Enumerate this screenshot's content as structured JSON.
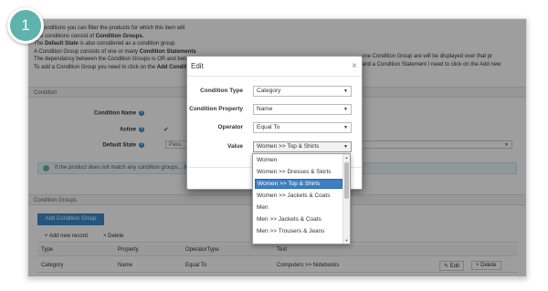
{
  "step_number": "1",
  "intro": {
    "line1": "ith conditions you can filter the products for which this item will",
    "line2_a": "The conditions consist of ",
    "line2_b": "Condition Groups.",
    "line3_a": "The ",
    "line3_b": "Default State",
    "line3_c": " is also considered as a condition group.",
    "line4_a": "A Condition Group consists of one or many ",
    "line4_b": "Condition Statements",
    "line5": "The dependancy between the Condition Groups is OR and betw",
    "line6_a": "To add a Condition Group you need to click on the ",
    "line6_b": "Add Conditi",
    "right1": "one Condition Group are will be displayed over that pr",
    "right2": "and a Condition Statement I need to click on the Add new"
  },
  "condition_section": {
    "header": "Condition",
    "name_label": "Condition Name",
    "active_label": "Active",
    "active_check": "✔",
    "default_state_label": "Default State",
    "default_state_value": "Pass",
    "info": "If the product does not match any condition groups... thod\" unless you want to show on every product"
  },
  "groups_section": {
    "header": "Condition Groups",
    "add_group_button": "Add Condition Group",
    "add_record": "+ Add new record",
    "delete": "× Delete",
    "columns": [
      "Type",
      "Property",
      "OperatorType",
      "Text"
    ],
    "row": {
      "type": "Category",
      "property": "Name",
      "operator": "Equal To",
      "text": "Computers >> Notebooks"
    },
    "edit_btn": "✎ Edit",
    "delete_btn": "× Delete"
  },
  "modal": {
    "title": "Edit",
    "close": "×",
    "fields": [
      {
        "label": "Condition Type",
        "value": "Category"
      },
      {
        "label": "Condition Property",
        "value": "Name"
      },
      {
        "label": "Operator",
        "value": "Equal To"
      },
      {
        "label": "Value",
        "value": "Women >> Top & Shirts"
      }
    ],
    "dropdown_options": [
      "Women",
      "Women >> Dresses & Skirts",
      "Women >> Top & Shirts",
      "Women >> Jackets & Coats",
      "Men",
      "Men >> Jackets & Coats",
      "Men >> Trousers & Jeans"
    ],
    "selected_option_index": 2
  },
  "colors": {
    "accent": "#5fb3ad",
    "primary": "#3a89c9",
    "selected": "#3d7fc1"
  },
  "icons": {
    "caret": "▼",
    "up": "▲",
    "help": "?"
  }
}
